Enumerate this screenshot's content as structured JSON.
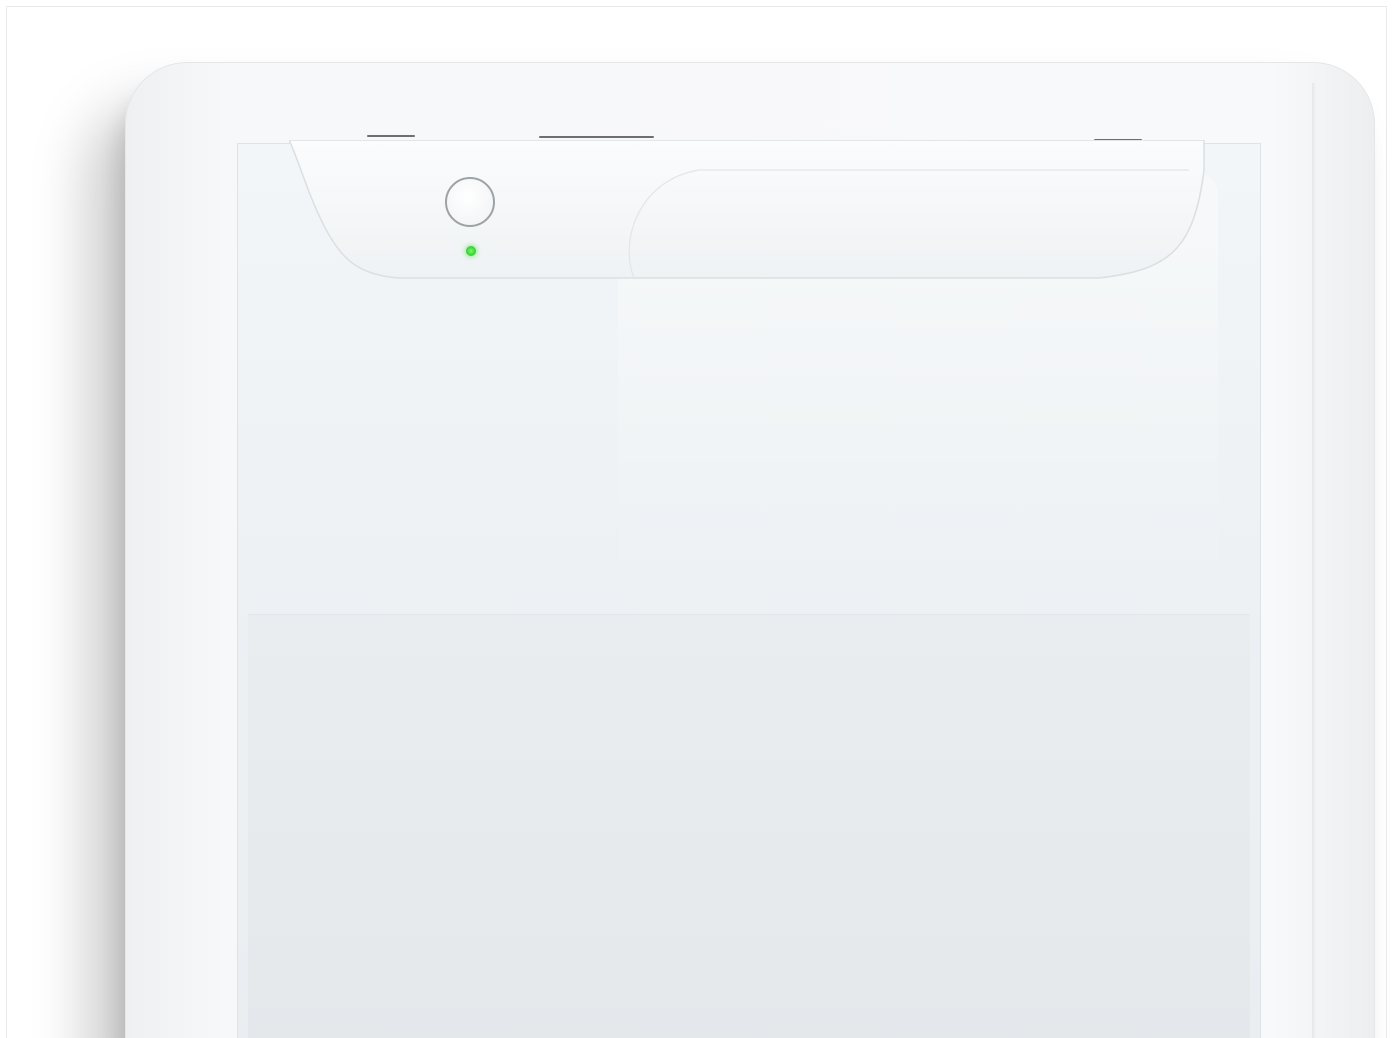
{
  "scene": {
    "subject": "white-tablet-device-closeup",
    "colors": {
      "background": "#ffffff",
      "device_body": "#f7f8f9",
      "screen": "#edf1f4",
      "indicator_led": "#3ed63a",
      "camera_ring": "#9da2a6"
    },
    "icons": {
      "camera": "camera-lens-icon",
      "status_light": "status-led-icon"
    },
    "indicator_led_on": true
  }
}
